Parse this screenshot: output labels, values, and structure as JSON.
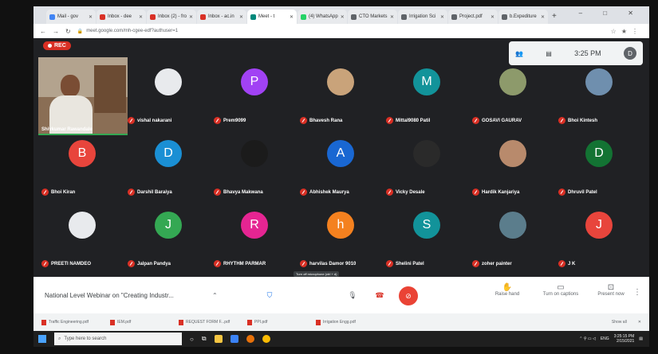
{
  "browser": {
    "tabs": [
      {
        "label": "Mail - gov",
        "color": "#4285f4",
        "active": false
      },
      {
        "label": "Inbox - dee",
        "color": "#d93025",
        "active": false
      },
      {
        "label": "Inbox (2) - fro",
        "color": "#d93025",
        "active": false
      },
      {
        "label": "Inbox - ac.in",
        "color": "#d93025",
        "active": false
      },
      {
        "label": "Meet - t",
        "color": "#00897b",
        "active": true
      },
      {
        "label": "(4) WhatsApp",
        "color": "#25d366",
        "active": false
      },
      {
        "label": "CTO Markets",
        "color": "#5f6368",
        "active": false
      },
      {
        "label": "Irrigation Sci",
        "color": "#5f6368",
        "active": false
      },
      {
        "label": "Project.pdf",
        "color": "#5f6368",
        "active": false
      },
      {
        "label": "b.Expediture",
        "color": "#5f6368",
        "active": false
      }
    ],
    "url": "meet.google.com/mh-cgee-edf?authuser=1"
  },
  "meet": {
    "rec_label": "REC",
    "time": "3:25 PM",
    "you_initial": "D",
    "self_view_name": "Shivkumar Rawandale",
    "participants": [
      {
        "name": "vishal nakarani",
        "initial": "",
        "color": "#e8eaed"
      },
      {
        "name": "Prem9099",
        "initial": "P",
        "color": "#a142f4"
      },
      {
        "name": "Bhavesh Rana",
        "initial": "",
        "color": "#c9a37a"
      },
      {
        "name": "Mittal9080 Patil",
        "initial": "M",
        "color": "#12939a"
      },
      {
        "name": "GOSAVI GAURAV",
        "initial": "",
        "color": "#8d9a6b"
      },
      {
        "name": "Bhoi Kintesh",
        "initial": "",
        "color": "#6f8fae"
      },
      {
        "name": "Bhoi Kiran",
        "initial": "B",
        "color": "#e8453c"
      },
      {
        "name": "Darshil Baraiya",
        "initial": "D",
        "color": "#1a8fd4"
      },
      {
        "name": "Bhavya Makwana",
        "initial": "",
        "color": "#1b1b1b"
      },
      {
        "name": "Abhishek Maurya",
        "initial": "A",
        "color": "#1967d2"
      },
      {
        "name": "Vicky Desale",
        "initial": "",
        "color": "#2a2a2a"
      },
      {
        "name": "Hardik Kanjariya",
        "initial": "",
        "color": "#b88a6c"
      },
      {
        "name": "Dhruvil Patel",
        "initial": "D",
        "color": "#137333"
      },
      {
        "name": "PREETI NAMDEO",
        "initial": "",
        "color": "#e8eaed"
      },
      {
        "name": "Jalpan Pandya",
        "initial": "J",
        "color": "#34a853"
      },
      {
        "name": "RHYTHM PARMAR",
        "initial": "R",
        "color": "#e52592"
      },
      {
        "name": "harvilas Damor 9010",
        "initial": "h",
        "color": "#f4811f"
      },
      {
        "name": "Shelini Patel",
        "initial": "S",
        "color": "#12939a"
      },
      {
        "name": "zoher painter",
        "initial": "",
        "color": "#5b7d8c"
      },
      {
        "name": "J K",
        "initial": "J",
        "color": "#e8453c"
      }
    ],
    "meeting_title": "National Level Webinar on \"Creating Industr...",
    "tooltip": "Turn off microphone (ctrl + d)",
    "raise_hand": "Raise hand",
    "captions": "Turn on captions",
    "present": "Present now"
  },
  "downloads": {
    "items": [
      "Traffic Engineering.pdf",
      "IEM.pdf",
      "REQUEST FORM F...pdf",
      "PPI.pdf",
      "Irrigation Engg.pdf"
    ],
    "show_all": "Show all"
  },
  "taskbar": {
    "search_placeholder": "Type here to search",
    "clock_time": "3:25:15 PM",
    "clock_date": "2/15/2021",
    "lang": "ENG"
  }
}
